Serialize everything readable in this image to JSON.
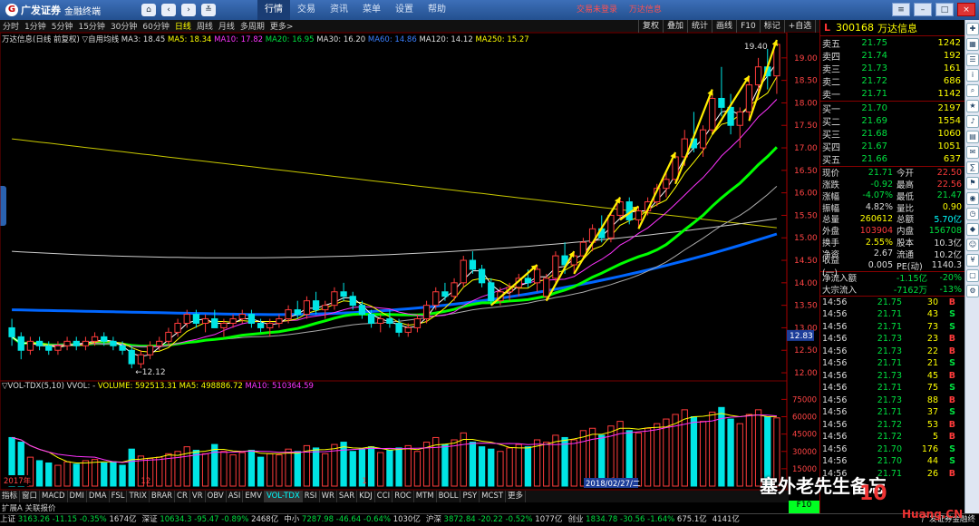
{
  "app": {
    "brand": "广发证券",
    "subtitle": "金融终端"
  },
  "top_menu": [
    {
      "label": "行情",
      "active": true
    },
    {
      "label": "交易"
    },
    {
      "label": "资讯"
    },
    {
      "label": "菜单"
    },
    {
      "label": "设置"
    },
    {
      "label": "帮助"
    }
  ],
  "top_right": {
    "trade_status": "交易未登录",
    "stock_name": "万达信息"
  },
  "periods": [
    {
      "label": "分时"
    },
    {
      "label": "1分钟"
    },
    {
      "label": "5分钟"
    },
    {
      "label": "15分钟"
    },
    {
      "label": "30分钟"
    },
    {
      "label": "60分钟"
    },
    {
      "label": "日线",
      "active": true
    },
    {
      "label": "周线"
    },
    {
      "label": "月线"
    },
    {
      "label": "多周期"
    },
    {
      "label": "更多>"
    }
  ],
  "tool_buttons": [
    "复权",
    "叠加",
    "统计",
    "画线",
    "F10",
    "标记",
    "+自选",
    "返回"
  ],
  "chart_info": {
    "title": "万达信息(日线 前复权)",
    "indicator": "▽自用均线",
    "ma3": "MA3: 18.45",
    "ma5": "MA5: 18.34",
    "ma10": "MA10: 17.82",
    "ma20": "MA20: 16.95",
    "ma30": "MA30: 16.20",
    "ma60": "MA60: 14.86",
    "ma120": "MA120: 14.12",
    "ma250": "MA250: 15.27"
  },
  "vol_info": {
    "title": "▽VOL-TDX(5,10)",
    "wvol": "VVOL: -",
    "volume": "VOLUME: 592513.31",
    "ma5": "MA5: 498886.72",
    "ma10": "MA10: 510364.59"
  },
  "price_axis": [
    "19.00",
    "18.50",
    "18.00",
    "17.50",
    "17.00",
    "16.50",
    "16.00",
    "15.50",
    "15.00",
    "14.50",
    "14.00",
    "13.50",
    "13.00",
    "12.50",
    "12.00"
  ],
  "vol_axis": [
    "75000",
    "60000",
    "45000",
    "30000",
    "15000"
  ],
  "annotations": {
    "high": "19.40",
    "low": "12.12",
    "current": "12.83"
  },
  "date_labels": {
    "year": "2017年",
    "m12": "12",
    "m1": "1",
    "m2": "2",
    "cursor": "2018/02/27/二"
  },
  "bottom_tabs": [
    "指标",
    "窗口",
    "MACD",
    "DMI",
    "DMA",
    "FSL",
    "TRIX",
    "BRAR",
    "CR",
    "VR",
    "OBV",
    "ASI",
    "EMV",
    "VOL-TDX",
    "RSI",
    "WR",
    "SAR",
    "KDJ",
    "CCI",
    "ROC",
    "MTM",
    "BOLL",
    "PSY",
    "MCST",
    "更多"
  ],
  "bottom_active": "VOL-TDX",
  "bottom2_label": "扩展A 关联报价",
  "status": [
    {
      "n": "上证",
      "v": "3163.26",
      "c": "-11.15",
      "p": "-0.35%",
      "a": "1674亿"
    },
    {
      "n": "深证",
      "v": "10634.3",
      "c": "-95.47",
      "p": "-0.89%",
      "a": "2468亿"
    },
    {
      "n": "中小",
      "v": "7287.98",
      "c": "-46.64",
      "p": "-0.64%",
      "a": "1030亿"
    },
    {
      "n": "沪深",
      "v": "3872.84",
      "c": "-20.22",
      "p": "-0.52%",
      "a": "1077亿"
    },
    {
      "n": "创业",
      "v": "1834.78",
      "c": "-30.56",
      "p": "-1.64%",
      "a": "675.1亿"
    },
    {
      "n": "4141亿",
      "v": "",
      "c": "",
      "p": "",
      "a": ""
    }
  ],
  "status_right": "广发证券金融终",
  "stock": {
    "flag": "L",
    "code": "300168",
    "name": "万达信息"
  },
  "asks": [
    {
      "l": "卖五",
      "p": "21.75",
      "v": "1242"
    },
    {
      "l": "卖四",
      "p": "21.74",
      "v": "192"
    },
    {
      "l": "卖三",
      "p": "21.73",
      "v": "161"
    },
    {
      "l": "卖二",
      "p": "21.72",
      "v": "686"
    },
    {
      "l": "卖一",
      "p": "21.71",
      "v": "1142"
    }
  ],
  "bids": [
    {
      "l": "买一",
      "p": "21.70",
      "v": "2197"
    },
    {
      "l": "买二",
      "p": "21.69",
      "v": "1554"
    },
    {
      "l": "买三",
      "p": "21.68",
      "v": "1060"
    },
    {
      "l": "买四",
      "p": "21.67",
      "v": "1051"
    },
    {
      "l": "买五",
      "p": "21.66",
      "v": "637"
    }
  ],
  "quote": [
    {
      "k1": "现价",
      "v1": "21.71",
      "c1": "gn",
      "k2": "今开",
      "v2": "22.50",
      "c2": "rd"
    },
    {
      "k1": "涨跌",
      "v1": "-0.92",
      "c1": "gn",
      "k2": "最高",
      "v2": "22.56",
      "c2": "rd"
    },
    {
      "k1": "涨幅",
      "v1": "-4.07%",
      "c1": "gn",
      "k2": "最低",
      "v2": "21.47",
      "c2": "gn"
    },
    {
      "k1": "振幅",
      "v1": "4.82%",
      "c1": "wh",
      "k2": "量比",
      "v2": "0.90",
      "c2": "yl"
    },
    {
      "k1": "总量",
      "v1": "260612",
      "c1": "yl",
      "k2": "总额",
      "v2": "5.70亿",
      "c2": "cy"
    },
    {
      "k1": "外盘",
      "v1": "103904",
      "c1": "rd",
      "k2": "内盘",
      "v2": "156708",
      "c2": "gn"
    },
    {
      "k1": "换手",
      "v1": "2.55%",
      "c1": "yl",
      "k2": "股本",
      "v2": "10.3亿",
      "c2": "wh"
    },
    {
      "k1": "净资",
      "v1": "2.67",
      "c1": "wh",
      "k2": "流通",
      "v2": "10.2亿",
      "c2": "wh"
    },
    {
      "k1": "收益(一)",
      "v1": "0.005",
      "c1": "wh",
      "k2": "PE(动)",
      "v2": "1140.3",
      "c2": "wh"
    }
  ],
  "flow": [
    {
      "k": "净流入额",
      "v1": "-1.15亿",
      "v2": "-20%"
    },
    {
      "k": "大宗流入",
      "v1": "-7162万",
      "v2": "-13%"
    }
  ],
  "ticks": [
    {
      "t": "14:56",
      "p": "21.75",
      "v": "30",
      "d": "B"
    },
    {
      "t": "14:56",
      "p": "21.71",
      "v": "43",
      "d": "S"
    },
    {
      "t": "14:56",
      "p": "21.71",
      "v": "73",
      "d": "S"
    },
    {
      "t": "14:56",
      "p": "21.73",
      "v": "23",
      "d": "B"
    },
    {
      "t": "14:56",
      "p": "21.73",
      "v": "22",
      "d": "B"
    },
    {
      "t": "14:56",
      "p": "21.71",
      "v": "21",
      "d": "S"
    },
    {
      "t": "14:56",
      "p": "21.73",
      "v": "45",
      "d": "B"
    },
    {
      "t": "14:56",
      "p": "21.71",
      "v": "75",
      "d": "S"
    },
    {
      "t": "14:56",
      "p": "21.73",
      "v": "88",
      "d": "B"
    },
    {
      "t": "14:56",
      "p": "21.71",
      "v": "37",
      "d": "S"
    },
    {
      "t": "14:56",
      "p": "21.72",
      "v": "53",
      "d": "B"
    },
    {
      "t": "14:56",
      "p": "21.72",
      "v": "5",
      "d": "B"
    },
    {
      "t": "14:56",
      "p": "21.70",
      "v": "176",
      "d": "S"
    },
    {
      "t": "14:56",
      "p": "21.70",
      "v": "44",
      "d": "S"
    },
    {
      "t": "14:56",
      "p": "21.71",
      "v": "26",
      "d": "B"
    }
  ],
  "watermark": {
    "text": "塞外老先生备忘",
    "logo": "10",
    "site": "Huang.CN"
  },
  "colors": {
    "up": "#ff3b3b",
    "down": "#00e5e5",
    "ma3": "#ffffff",
    "ma5": "#ffff00",
    "ma10": "#ff33ff",
    "ma20": "#00ff00",
    "ma30": "#aaaaaa",
    "ma60": "#0066ff",
    "ma120": "#cccccc",
    "ma250": "#c8c800",
    "arrow": "#ffee00"
  },
  "chart_data": {
    "type": "candlestick",
    "ylim": [
      11.9,
      19.4
    ],
    "candles": [
      [
        13.0,
        13.2,
        12.6,
        12.8
      ],
      [
        12.8,
        12.9,
        12.3,
        12.5
      ],
      [
        12.5,
        12.8,
        12.4,
        12.7
      ],
      [
        12.7,
        12.8,
        12.5,
        12.6
      ],
      [
        12.6,
        12.7,
        12.4,
        12.5
      ],
      [
        12.5,
        12.7,
        12.4,
        12.6
      ],
      [
        12.6,
        12.8,
        12.5,
        12.7
      ],
      [
        12.7,
        12.8,
        12.5,
        12.6
      ],
      [
        12.6,
        12.8,
        12.5,
        12.7
      ],
      [
        12.7,
        12.9,
        12.6,
        12.8
      ],
      [
        12.8,
        12.9,
        12.6,
        12.7
      ],
      [
        12.7,
        12.8,
        12.5,
        12.6
      ],
      [
        12.6,
        12.7,
        12.4,
        12.5
      ],
      [
        12.5,
        12.6,
        12.1,
        12.2
      ],
      [
        12.2,
        12.5,
        12.1,
        12.4
      ],
      [
        12.4,
        12.7,
        12.3,
        12.6
      ],
      [
        12.6,
        12.8,
        12.5,
        12.7
      ],
      [
        12.7,
        13.0,
        12.6,
        12.9
      ],
      [
        12.9,
        13.2,
        12.8,
        13.1
      ],
      [
        13.1,
        13.4,
        13.0,
        13.3
      ],
      [
        13.3,
        13.4,
        13.0,
        13.1
      ],
      [
        13.1,
        13.3,
        12.9,
        13.2
      ],
      [
        13.2,
        13.4,
        13.0,
        13.0
      ],
      [
        13.0,
        13.2,
        12.8,
        13.1
      ],
      [
        13.1,
        13.3,
        13.0,
        13.2
      ],
      [
        13.2,
        13.4,
        13.1,
        13.3
      ],
      [
        13.3,
        13.4,
        13.0,
        13.1
      ],
      [
        13.1,
        13.2,
        12.9,
        13.0
      ],
      [
        13.0,
        13.2,
        12.8,
        13.1
      ],
      [
        13.1,
        13.3,
        13.0,
        13.2
      ],
      [
        13.2,
        13.5,
        13.1,
        13.4
      ],
      [
        13.4,
        13.6,
        13.2,
        13.3
      ],
      [
        13.3,
        13.7,
        13.2,
        13.6
      ],
      [
        13.6,
        13.8,
        13.3,
        13.4
      ],
      [
        13.4,
        13.6,
        13.2,
        13.5
      ],
      [
        13.5,
        13.9,
        13.4,
        13.8
      ],
      [
        13.8,
        14.0,
        13.6,
        13.7
      ],
      [
        13.7,
        13.8,
        13.4,
        13.5
      ],
      [
        13.5,
        13.6,
        13.2,
        13.3
      ],
      [
        13.3,
        13.4,
        13.0,
        13.1
      ],
      [
        13.1,
        13.3,
        12.9,
        13.2
      ],
      [
        13.2,
        13.4,
        13.0,
        13.1
      ],
      [
        13.1,
        13.2,
        12.8,
        12.9
      ],
      [
        12.9,
        13.1,
        12.8,
        13.0
      ],
      [
        13.0,
        13.3,
        12.9,
        13.2
      ],
      [
        13.2,
        13.6,
        13.1,
        13.5
      ],
      [
        13.5,
        13.9,
        13.4,
        13.8
      ],
      [
        13.8,
        14.0,
        13.6,
        13.7
      ],
      [
        13.7,
        14.1,
        13.6,
        14.0
      ],
      [
        14.0,
        14.6,
        13.9,
        14.5
      ],
      [
        14.5,
        14.7,
        14.2,
        14.3
      ],
      [
        14.3,
        14.4,
        13.9,
        14.0
      ],
      [
        14.0,
        14.1,
        13.5,
        13.6
      ],
      [
        13.6,
        13.9,
        13.5,
        13.8
      ],
      [
        13.8,
        14.0,
        13.6,
        13.9
      ],
      [
        13.9,
        14.2,
        13.7,
        14.1
      ],
      [
        14.1,
        14.3,
        13.9,
        14.0
      ],
      [
        14.0,
        14.4,
        13.8,
        14.3
      ],
      [
        13.7,
        14.2,
        13.6,
        14.1
      ],
      [
        14.1,
        14.7,
        14.0,
        14.6
      ],
      [
        14.6,
        14.9,
        14.2,
        14.4
      ],
      [
        14.4,
        14.7,
        14.2,
        14.6
      ],
      [
        14.6,
        15.0,
        14.5,
        14.9
      ],
      [
        14.9,
        15.3,
        14.7,
        15.2
      ],
      [
        15.2,
        15.5,
        14.9,
        15.0
      ],
      [
        15.0,
        15.6,
        14.9,
        15.5
      ],
      [
        15.5,
        15.9,
        15.4,
        15.8
      ],
      [
        15.8,
        15.9,
        15.3,
        15.4
      ],
      [
        15.4,
        15.7,
        15.2,
        15.6
      ],
      [
        15.6,
        15.9,
        15.5,
        15.8
      ],
      [
        15.8,
        16.2,
        15.7,
        16.1
      ],
      [
        16.1,
        16.5,
        15.9,
        16.3
      ],
      [
        16.3,
        16.9,
        16.2,
        16.8
      ],
      [
        16.8,
        17.4,
        16.6,
        17.2
      ],
      [
        17.2,
        17.8,
        16.9,
        17.0
      ],
      [
        17.0,
        17.5,
        16.8,
        17.4
      ],
      [
        17.4,
        18.3,
        17.3,
        18.1
      ],
      [
        18.1,
        18.8,
        17.7,
        17.9
      ],
      [
        17.9,
        18.2,
        17.3,
        17.5
      ],
      [
        17.5,
        17.9,
        17.0,
        17.8
      ],
      [
        17.8,
        18.6,
        17.6,
        18.4
      ],
      [
        18.4,
        19.0,
        18.1,
        18.8
      ],
      [
        18.8,
        19.2,
        18.3,
        18.6
      ],
      [
        18.6,
        19.4,
        18.2,
        19.3
      ]
    ],
    "volumes": [
      42000,
      38000,
      25000,
      22000,
      20000,
      18000,
      21000,
      19000,
      22000,
      23000,
      20000,
      21000,
      18000,
      32000,
      26000,
      24000,
      25000,
      28000,
      30000,
      34000,
      31000,
      28000,
      36000,
      30000,
      27000,
      29000,
      31000,
      25000,
      28000,
      27000,
      32000,
      30000,
      35000,
      33000,
      28000,
      36000,
      38000,
      30000,
      32000,
      34000,
      29000,
      31000,
      33000,
      35000,
      30000,
      38000,
      42000,
      36000,
      40000,
      46000,
      38000,
      34000,
      32000,
      30000,
      33000,
      36000,
      34000,
      40000,
      38000,
      44000,
      42000,
      40000,
      48000,
      50000,
      44000,
      52000,
      56000,
      48000,
      46000,
      50000,
      54000,
      58000,
      62000,
      66000,
      60000,
      56000,
      64000,
      68000,
      58000,
      54000,
      62000,
      66000,
      60000,
      59000
    ]
  }
}
